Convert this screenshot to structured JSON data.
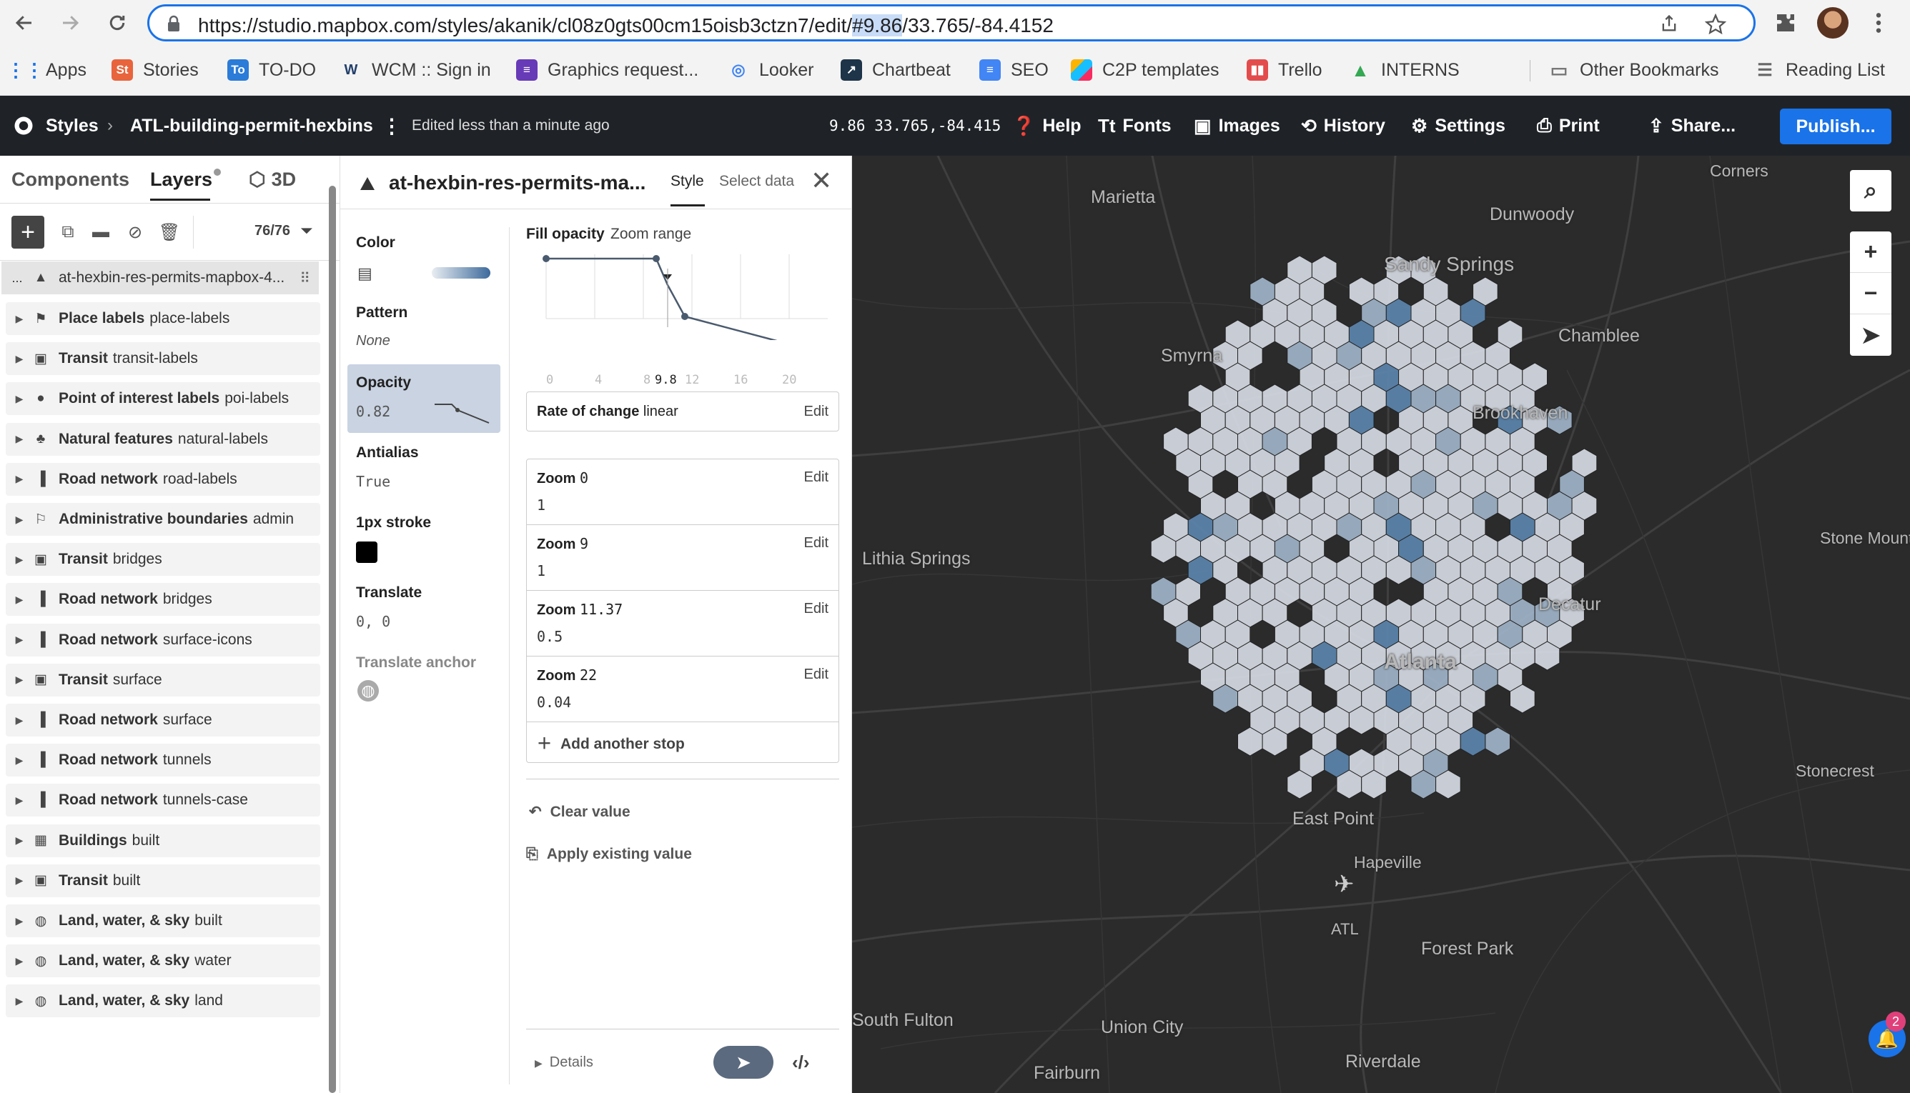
{
  "browser": {
    "url_prefix": "https://studio.mapbox.com/styles/akanik/cl08z0gts00cm15oisb3ctzn7/edit/",
    "url_highlight": "#9.86",
    "url_suffix": "/33.765/-84.4152",
    "bookmarks": [
      "Apps",
      "Stories",
      "TO-DO",
      "WCM :: Sign in",
      "Graphics request...",
      "Looker",
      "Chartbeat",
      "SEO",
      "C2P templates",
      "Trello",
      "INTERNS",
      "Other Bookmarks",
      "Reading List"
    ]
  },
  "appbar": {
    "styles_label": "Styles",
    "style_name": "ATL-building-permit-hexbins",
    "status": "Edited less than a minute ago",
    "coords": "9.86 33.765,-84.415",
    "help": "Help",
    "fonts": "Fonts",
    "images": "Images",
    "history": "History",
    "settings": "Settings",
    "print": "Print",
    "share": "Share...",
    "publish": "Publish..."
  },
  "layers_panel": {
    "tab_components": "Components",
    "tab_layers": "Layers",
    "tab_3d": "3D",
    "count": "76/76",
    "selected_layer": "at-hexbin-res-permits-mapbox-4...",
    "selected_prefix": "...",
    "rows": [
      {
        "group": "Place labels",
        "name": "place-labels",
        "icon": "pin-label-icon"
      },
      {
        "group": "Transit",
        "name": "transit-labels",
        "icon": "bus-icon"
      },
      {
        "group": "Point of interest labels",
        "name": "poi-labels",
        "icon": "map-pin-icon"
      },
      {
        "group": "Natural features",
        "name": "natural-labels",
        "icon": "tree-icon"
      },
      {
        "group": "Road network",
        "name": "road-labels",
        "icon": "road-icon"
      },
      {
        "group": "Administrative boundaries",
        "name": "admin",
        "icon": "flag-icon"
      },
      {
        "group": "Transit",
        "name": "bridges",
        "icon": "bus-icon"
      },
      {
        "group": "Road network",
        "name": "bridges",
        "icon": "road-icon"
      },
      {
        "group": "Road network",
        "name": "surface-icons",
        "icon": "road-icon"
      },
      {
        "group": "Transit",
        "name": "surface",
        "icon": "bus-icon"
      },
      {
        "group": "Road network",
        "name": "surface",
        "icon": "road-icon"
      },
      {
        "group": "Road network",
        "name": "tunnels",
        "icon": "road-icon"
      },
      {
        "group": "Road network",
        "name": "tunnels-case",
        "icon": "road-icon"
      },
      {
        "group": "Buildings",
        "name": "built",
        "icon": "building-icon"
      },
      {
        "group": "Transit",
        "name": "built",
        "icon": "bus-icon"
      },
      {
        "group": "Land, water, & sky",
        "name": "built",
        "icon": "globe-icon"
      },
      {
        "group": "Land, water, & sky",
        "name": "water",
        "icon": "globe-icon"
      },
      {
        "group": "Land, water, & sky",
        "name": "land",
        "icon": "globe-icon"
      }
    ]
  },
  "editor": {
    "layer_title": "at-hexbin-res-permits-ma...",
    "tab_style": "Style",
    "tab_select": "Select data",
    "props": {
      "color_label": "Color",
      "pattern_label": "Pattern",
      "pattern_value": "None",
      "opacity_label": "Opacity",
      "opacity_value": "0.82",
      "antialias_label": "Antialias",
      "antialias_value": "True",
      "stroke_label": "1px stroke",
      "stroke_color": "#000000",
      "translate_label": "Translate",
      "translate_value": "0, 0",
      "anchor_label": "Translate anchor"
    },
    "fill_opacity_label": "Fill opacity",
    "zoom_range_label": "Zoom range",
    "graph_ticks": [
      "0",
      "4",
      "8",
      "9.8",
      "12",
      "16",
      "20"
    ],
    "rate_label": "Rate of change",
    "rate_value": "linear",
    "edit": "Edit",
    "stops": [
      {
        "zoom": "0",
        "value": "1"
      },
      {
        "zoom": "9",
        "value": "1"
      },
      {
        "zoom": "11.37",
        "value": "0.5"
      },
      {
        "zoom": "22",
        "value": "0.04"
      }
    ],
    "zoom_word": "Zoom",
    "add_stop": "Add another stop",
    "clear_value": "Clear value",
    "apply_existing": "Apply existing value",
    "details": "Details"
  },
  "map": {
    "cities": [
      "Marietta",
      "Dunwoody",
      "Sandy Springs",
      "Chamblee",
      "Smyrna",
      "Brookhaven",
      "Lithia Springs",
      "Stone Mount",
      "Decatur",
      "Atlanta",
      "Stonecrest",
      "East Point",
      "Hapeville",
      "ATL",
      "Forest Park",
      "South Fulton",
      "Union City",
      "Fairburn",
      "Riverdale",
      "Corners"
    ],
    "notification_count": "2",
    "colors": {
      "hex_light": "#d6dae3",
      "hex_mid": "#9fb3c8",
      "hex_blue": "#5b84ad",
      "accent": "#1a73e8"
    }
  }
}
